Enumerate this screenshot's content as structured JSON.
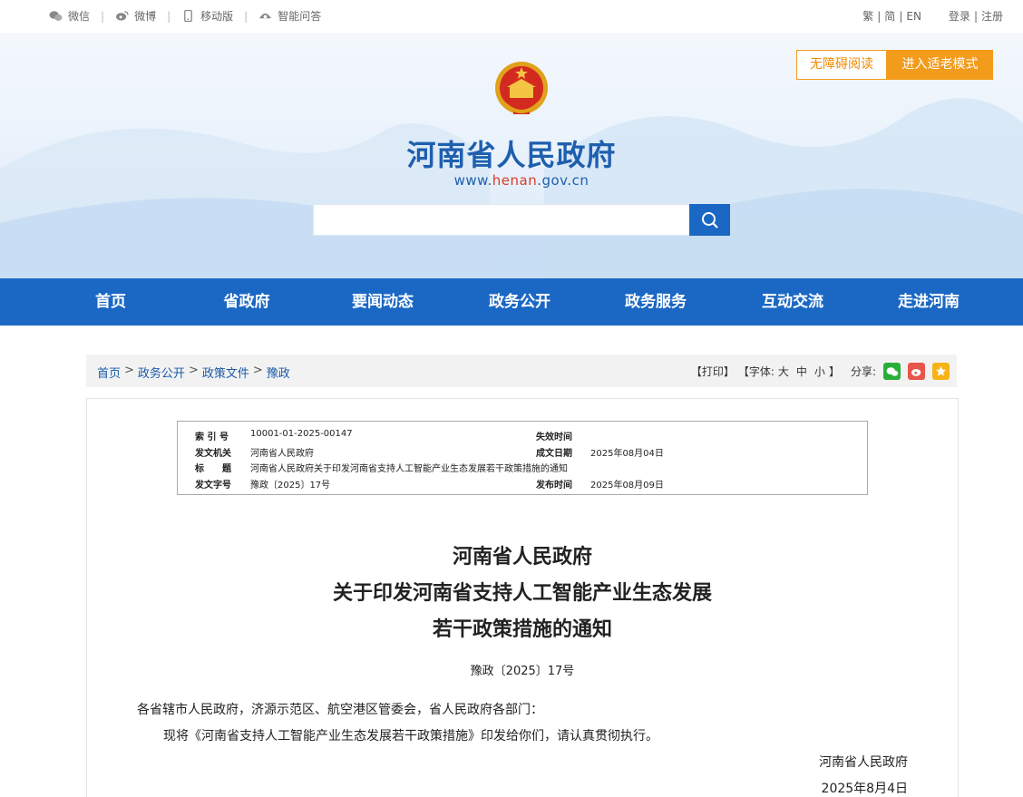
{
  "topbar": {
    "links": [
      "微信",
      "微博",
      "移动版",
      "智能问答"
    ],
    "lang": [
      "繁",
      "简",
      "EN"
    ],
    "login": "登录",
    "register": "注册"
  },
  "header": {
    "title": "河南省人民政府",
    "url_prefix": "www.",
    "url_accent": "henan",
    "url_suffix": ".gov.cn",
    "search_placeholder": "",
    "btn_accessible": "无障碍阅读",
    "btn_elder": "进入适老模式"
  },
  "nav": [
    "首页",
    "省政府",
    "要闻动态",
    "政务公开",
    "政务服务",
    "互动交流",
    "走进河南"
  ],
  "breadcrumb": {
    "items": [
      "首页",
      "政务公开",
      "政策文件",
      "豫政"
    ],
    "separator": ">",
    "print": "【打印】",
    "font_label": "【字体:",
    "font_sizes": [
      "大",
      "中",
      "小"
    ],
    "font_close": "】",
    "share": "分享:"
  },
  "meta": {
    "index_label": "索 引 号",
    "index_value": "10001-01-2025-00147",
    "expire_label": "失效时间",
    "expire_value": "",
    "issuer_label": "发文机关",
    "issuer_value": "河南省人民政府",
    "written_label": "成文日期",
    "written_value": "2025年08月04日",
    "title_label": "标　　题",
    "title_value": "河南省人民政府关于印发河南省支持人工智能产业生态发展若干政策措施的通知",
    "docno_label": "发文字号",
    "docno_value": "豫政〔2025〕17号",
    "publish_label": "发布时间",
    "publish_value": "2025年08月09日"
  },
  "document": {
    "title_lines": [
      "河南省人民政府",
      "关于印发河南省支持人工智能产业生态发展",
      "若干政策措施的通知"
    ],
    "doc_no": "豫政〔2025〕17号",
    "recipients": "各省辖市人民政府，济源示范区、航空港区管委会，省人民政府各部门：",
    "body": "现将《河南省支持人工智能产业生态发展若干政策措施》印发给你们，请认真贯彻执行。",
    "signature": "河南省人民政府",
    "date": "2025年8月4日"
  },
  "colors": {
    "brand_blue": "#1b68c4",
    "title_blue": "#1e5fae",
    "accent_orange": "#f39b1b",
    "url_red": "#d93a2b"
  }
}
